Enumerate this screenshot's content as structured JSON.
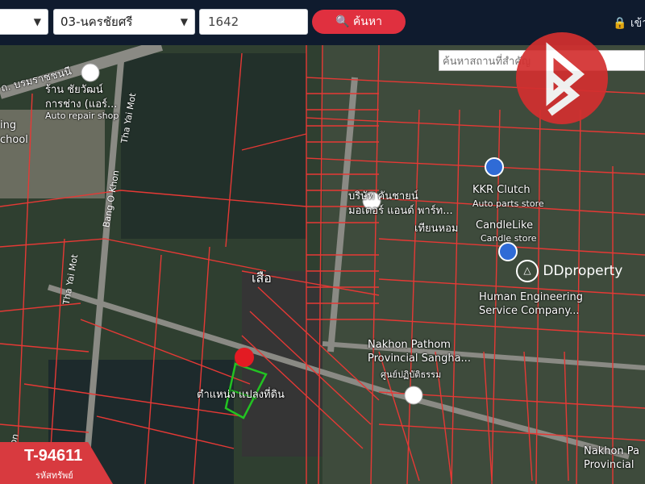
{
  "topbar": {
    "province_select": "03-นครชัยศรี",
    "parcel_input": "1642",
    "search_button": "ค้นหา",
    "login_label": "เข้าสู่"
  },
  "map": {
    "place_search_placeholder": "ค้นหาสถานที่สำคัญ",
    "labels": {
      "road_top": "ถ. บรมราชชนนี",
      "shop_thai": "ร้าน ชัยวัฒน์",
      "shop_thai2": "การช่าง (แอร์...",
      "auto_repair": "Auto repair shop",
      "school_en": "ing",
      "school_en2": "chool",
      "road_thayai_1": "Tha Yai Mot",
      "road_thayai_2": "Tha Yai Mot",
      "road_bangokhon": "Bang O Khon",
      "road_khon": "Khon",
      "company_thai": "บริษัท คันชายน์",
      "company_thai2": "มอเตอร์ แอนด์ พาร์ท...",
      "kkr": "KKR Clutch",
      "kkr_sub": "Auto parts store",
      "candle_thai": "เทียนหอม",
      "candle_en": "CandleLike",
      "candle_sub": "Candle store",
      "tiger": "เสือ",
      "human_eng": "Human Engineering",
      "human_eng2": "Service Company...",
      "nakhon1": "Nakhon Pathom",
      "nakhon2": "Provincial Sangha...",
      "nakhon_thai": "ศูนย์ปฏิบัติธรรม",
      "plot_label": "ตำแหน่ง แปลงที่ดิน",
      "nakhon_br1": "Nakhon Pa",
      "nakhon_br2": "Provincial"
    }
  },
  "watermark": "DDproperty",
  "badge": {
    "code": "T-94611",
    "sub": "รหัสทรัพย์"
  },
  "colors": {
    "accent": "#e0303f",
    "parcel_line": "#e53935",
    "highlight_parcel": "#22c322",
    "topbar": "#0f1b2e"
  }
}
